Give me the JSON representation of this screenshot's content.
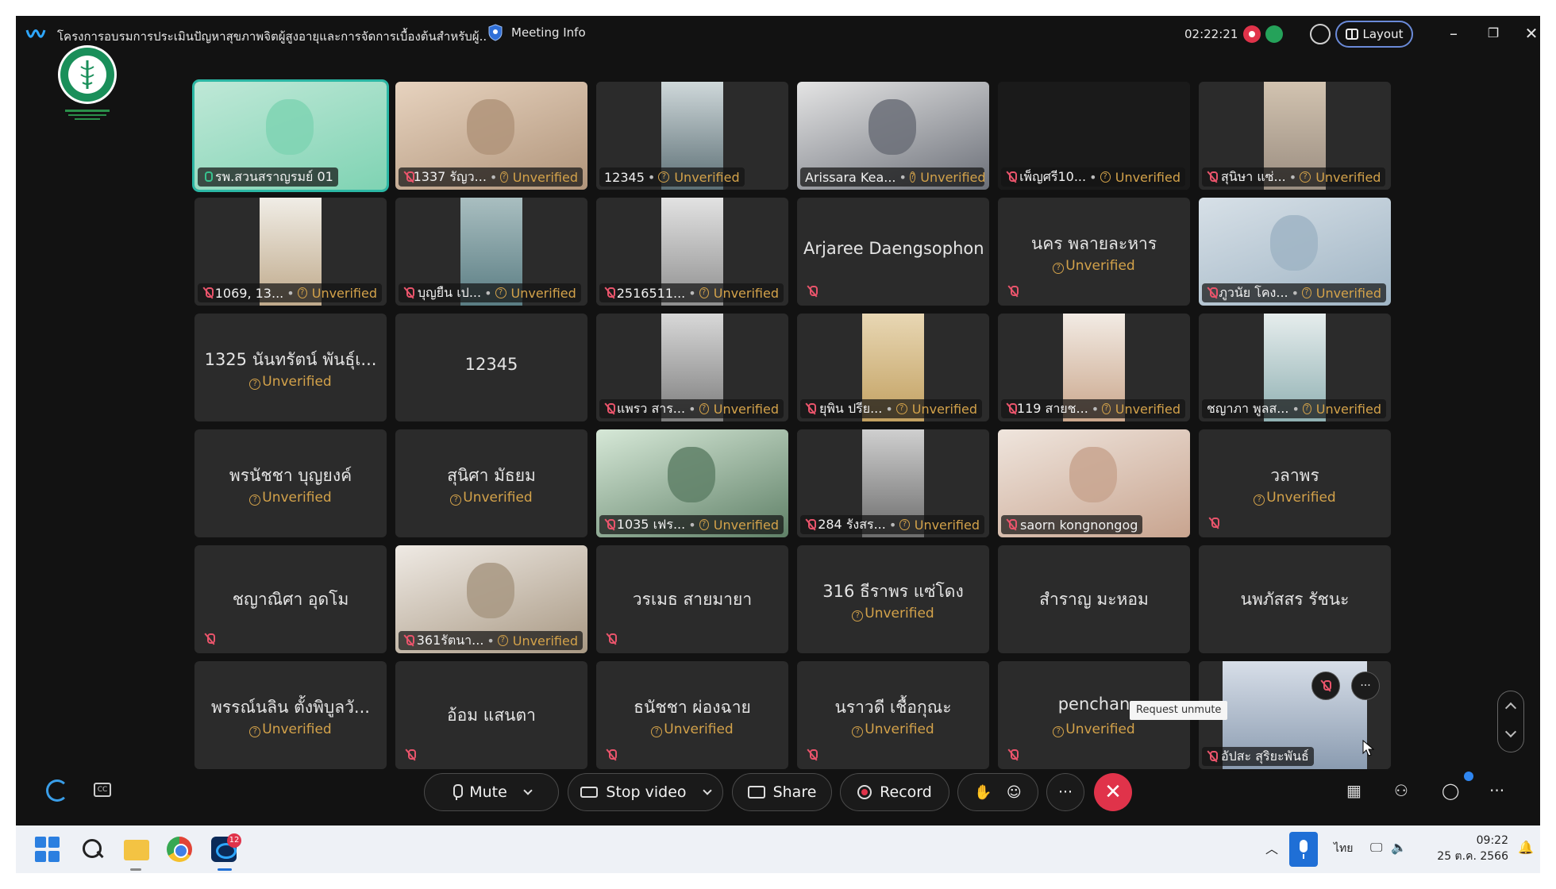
{
  "window": {
    "title": "โครงการอบรมการประเมินปัญหาสุขภาพจิตผู้สูงอายุและการจัดการเบื้องต้นสำหรับผู้...",
    "meeting_info_label": "Meeting Info",
    "elapsed_time": "02:22:21",
    "layout_label": "Layout"
  },
  "org_logo": {
    "name": "moph-logo"
  },
  "grid": {
    "tiles": [
      {
        "id": "t1",
        "type": "video",
        "name": "รพ.สวนสราญรมย์ 01",
        "unverified": "",
        "mic": "on",
        "active": true
      },
      {
        "id": "t2",
        "type": "video",
        "name": "1337 รัญว...",
        "unverified": "Unverified",
        "mic": "off"
      },
      {
        "id": "t3",
        "type": "video",
        "name": "12345",
        "unverified": "Unverified",
        "mic": "none"
      },
      {
        "id": "t4",
        "type": "video",
        "name": "Arissara Kea...",
        "unverified": "Unverified",
        "mic": "none"
      },
      {
        "id": "t5",
        "type": "video",
        "name": "เพ็ญศรี10...",
        "unverified": "Unverified",
        "mic": "off"
      },
      {
        "id": "t6",
        "type": "video",
        "name": "สุนิษา แซ่...",
        "unverified": "Unverified",
        "mic": "off"
      },
      {
        "id": "t7",
        "type": "video",
        "name": "1069, 13...",
        "unverified": "Unverified",
        "mic": "off"
      },
      {
        "id": "t8",
        "type": "video",
        "name": "บุญยืน เป...",
        "unverified": "Unverified",
        "mic": "off"
      },
      {
        "id": "t9",
        "type": "video",
        "name": "2516511...",
        "unverified": "Unverified",
        "mic": "off"
      },
      {
        "id": "t10",
        "type": "name",
        "name": "Arjaree Daengsophon",
        "unverified": "",
        "mic": "off"
      },
      {
        "id": "t11",
        "type": "name",
        "name": "นคร พลายละหาร",
        "unverified": "Unverified",
        "mic": "off"
      },
      {
        "id": "t12",
        "type": "video",
        "name": "ภูวนัย โคง...",
        "unverified": "Unverified",
        "mic": "off"
      },
      {
        "id": "t13",
        "type": "name",
        "name": "1325 นันทรัตน์ พันธุ์เ...",
        "unverified": "Unverified",
        "mic": "none"
      },
      {
        "id": "t14",
        "type": "name",
        "name": "12345",
        "unverified": "",
        "mic": "none"
      },
      {
        "id": "t15",
        "type": "video",
        "name": "แพรว สาร...",
        "unverified": "Unverified",
        "mic": "off"
      },
      {
        "id": "t16",
        "type": "video",
        "name": "ยุพิน ปรีย...",
        "unverified": "Unverified",
        "mic": "off"
      },
      {
        "id": "t17",
        "type": "video",
        "name": "119 สายช...",
        "unverified": "Unverified",
        "mic": "off"
      },
      {
        "id": "t18",
        "type": "video",
        "name": "ชญาภา พูลส...",
        "unverified": "Unverified",
        "mic": "none"
      },
      {
        "id": "t19",
        "type": "name",
        "name": "พรนัชชา บุญยงค์",
        "unverified": "Unverified",
        "mic": "none"
      },
      {
        "id": "t20",
        "type": "name",
        "name": "สุนิศา มัธยม",
        "unverified": "Unverified",
        "mic": "none"
      },
      {
        "id": "t21",
        "type": "video",
        "name": "1035 เฟร...",
        "unverified": "Unverified",
        "mic": "off"
      },
      {
        "id": "t22",
        "type": "video",
        "name": "284 รังสร...",
        "unverified": "Unverified",
        "mic": "off"
      },
      {
        "id": "t23",
        "type": "video",
        "name": "saorn kongnongog",
        "unverified": "",
        "mic": "off"
      },
      {
        "id": "t24",
        "type": "name",
        "name": "วลาพร",
        "unverified": "Unverified",
        "mic": "off"
      },
      {
        "id": "t25",
        "type": "name",
        "name": "ชญาณิศา อุดโม",
        "unverified": "",
        "mic": "off"
      },
      {
        "id": "t26",
        "type": "video",
        "name": "361รัตนา...",
        "unverified": "Unverified",
        "mic": "off"
      },
      {
        "id": "t27",
        "type": "name",
        "name": "วรเมธ สายมายา",
        "unverified": "",
        "mic": "off"
      },
      {
        "id": "t28",
        "type": "name",
        "name": "316 ธีราพร แซ่โดง",
        "unverified": "Unverified",
        "mic": "none"
      },
      {
        "id": "t29",
        "type": "name",
        "name": "สำราญ มะหอม",
        "unverified": "",
        "mic": "none"
      },
      {
        "id": "t30",
        "type": "name",
        "name": "นพภัสสร รัชนะ",
        "unverified": "",
        "mic": "none"
      },
      {
        "id": "t31",
        "type": "name",
        "name": "พรรณ์นลิน ตั้งพิบูลวั...",
        "unverified": "Unverified",
        "mic": "none"
      },
      {
        "id": "t32",
        "type": "name",
        "name": "อ้อม แสนตา",
        "unverified": "",
        "mic": "off"
      },
      {
        "id": "t33",
        "type": "name",
        "name": "ธนัชชา ผ่องฉาย",
        "unverified": "Unverified",
        "mic": "off"
      },
      {
        "id": "t34",
        "type": "name",
        "name": "นราวดี เชื้อกุณะ",
        "unverified": "Unverified",
        "mic": "off"
      },
      {
        "id": "t35",
        "type": "name",
        "name": "penchan",
        "unverified": "Unverified",
        "mic": "off"
      },
      {
        "id": "t36",
        "type": "video",
        "name": "อัปสะ สุริยะพันธ์",
        "unverified": "",
        "mic": "off"
      }
    ],
    "tooltip": "Request unmute",
    "more_glyph": "···"
  },
  "controls": {
    "mute_label": "Mute",
    "stop_video_label": "Stop video",
    "share_label": "Share",
    "record_label": "Record",
    "more_glyph": "···",
    "end_glyph": "✕",
    "cc_text": "CC"
  },
  "taskbar": {
    "webex_badge": "12",
    "language": "ไทย",
    "time": "09:22",
    "date": "25 ต.ค. 2566"
  },
  "colors": {
    "accent": "#2bb7a4",
    "unverified": "#d3a24a",
    "end_call": "#e0334a",
    "mic_off": "#e9546b"
  }
}
